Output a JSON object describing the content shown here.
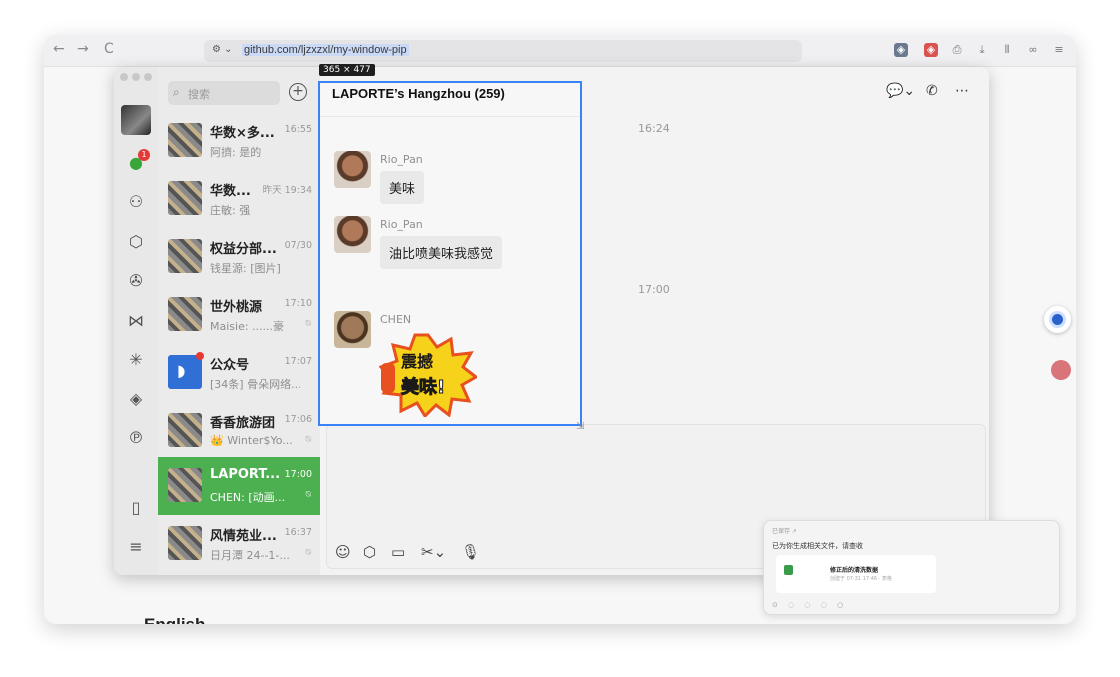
{
  "browser": {
    "url": "github.com/ljzxzxl/my-window-pip",
    "nav": [
      "←",
      "→",
      "C"
    ]
  },
  "page": {
    "section_heading": "English"
  },
  "wechat": {
    "search_placeholder": "搜索",
    "add_label": "+",
    "rail_badge": "1",
    "chats": [
      {
        "name": "华数×多...",
        "time": "16:55",
        "preview": "阿擠: 是的"
      },
      {
        "name": "华数...",
        "time": "昨天 19:34",
        "preview": "庄敏: 强"
      },
      {
        "name": "权益分部...",
        "time": "07/30",
        "preview": "钱星源: [图片]"
      },
      {
        "name": "世外桃源",
        "time": "17:10",
        "preview": "Maisie: ......豪"
      },
      {
        "name": "公众号",
        "time": "17:07",
        "preview": "[34条] 骨朵网络..."
      },
      {
        "name": "香香旅游团",
        "time": "17:06",
        "preview": "👑 Winter$Yo..."
      },
      {
        "name": "LAPORT...",
        "time": "17:00",
        "preview": "CHEN: [动画..."
      },
      {
        "name": "风情苑业...",
        "time": "16:37",
        "preview": "日月潭 24--1-..."
      }
    ],
    "main_times": [
      "16:24",
      "17:00"
    ]
  },
  "pip": {
    "size_tag": "365 × 477",
    "title": "LAPORTE’s Hangzhou (259)",
    "messages": [
      {
        "sender": "Rio_Pan",
        "text": "美味"
      },
      {
        "sender": "Rio_Pan",
        "text": "油比喷美味我感觉"
      },
      {
        "sender": "CHEN",
        "text": ""
      }
    ],
    "sticker": {
      "line1": "震撼",
      "line2": "美味!"
    }
  },
  "notification": {
    "header": "已保存 ↗",
    "text": "已为你生成相关文件，请查收",
    "file_title": "修正后的清洗数据",
    "file_meta": "创建于 07-31 17:46 · 表格",
    "icons": "⊙ ◌ ◌ ◌ ○"
  },
  "colors": {
    "accent": "#4caf50",
    "pip_border": "#3b82f6",
    "badge": "#e53935"
  }
}
